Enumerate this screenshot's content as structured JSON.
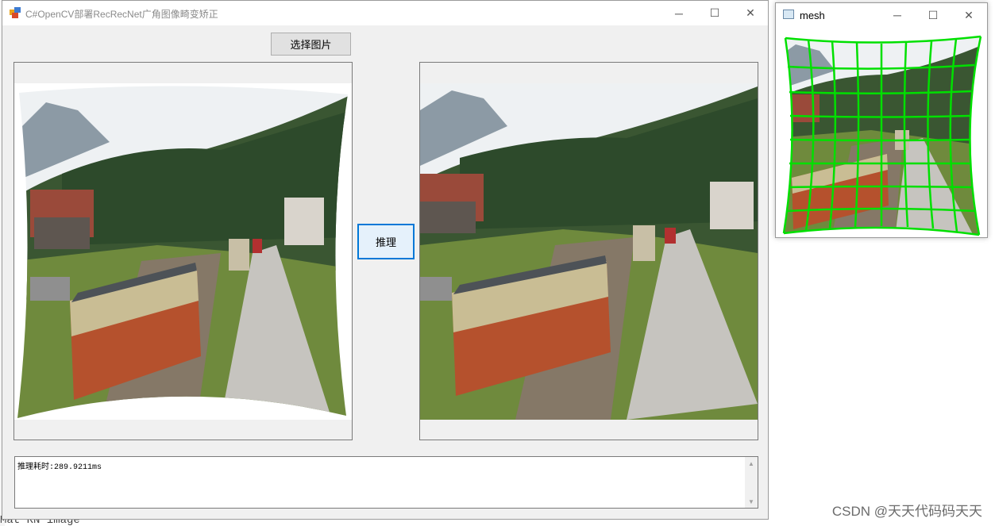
{
  "main_window": {
    "title": "C#OpenCV部署RecRecNet广角图像畸变矫正",
    "select_button": "选择图片",
    "infer_button": "推理",
    "output_text": "推理耗时:289.9211ms"
  },
  "mesh_window": {
    "title": "mesh"
  },
  "window_controls": {
    "minimize": "─",
    "maximize": "☐",
    "close": "✕"
  },
  "background": {
    "code_fragment": "Mat RN image"
  },
  "watermark": "CSDN @天天代码码天天",
  "colors": {
    "accent": "#0078d7",
    "mesh_grid": "#00e000",
    "window_bg": "#f0f0f0"
  },
  "icons": [
    "app-icon",
    "minimize-icon",
    "maximize-icon",
    "close-icon",
    "scroll-up-icon",
    "scroll-down-icon",
    "mesh-window-icon"
  ]
}
